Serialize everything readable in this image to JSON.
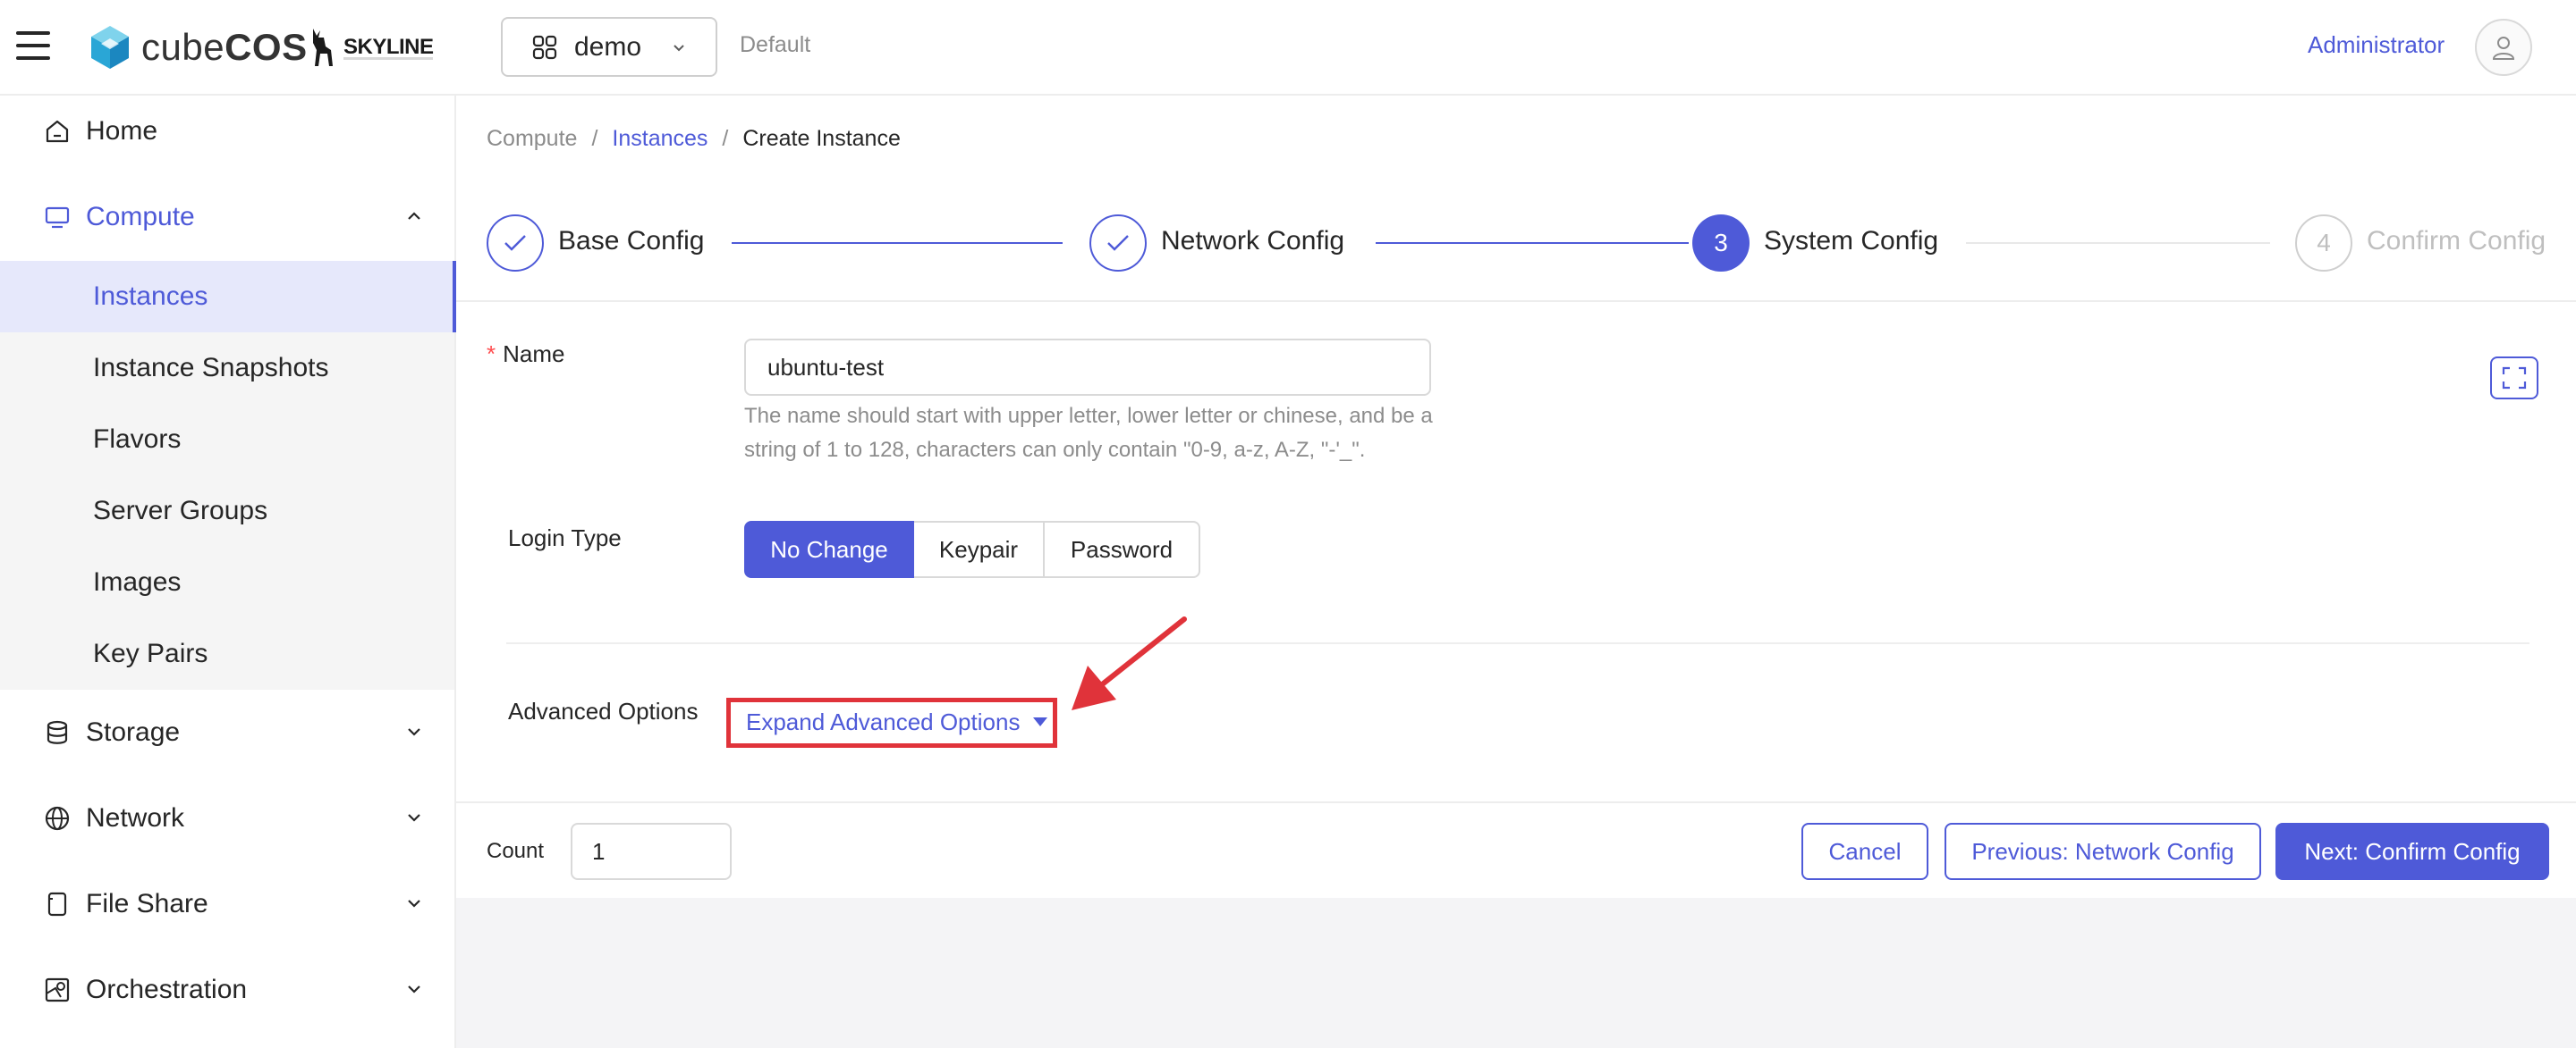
{
  "header": {
    "brand_prefix": "cube",
    "brand_suffix": "COS",
    "partner_logo_text": "SKYLINE",
    "project": "demo",
    "domain": "Default",
    "user": "Administrator"
  },
  "sidebar": {
    "items": [
      {
        "label": "Home",
        "icon": "home-icon"
      },
      {
        "label": "Compute",
        "icon": "monitor-icon",
        "expanded": true
      },
      {
        "label": "Storage",
        "icon": "database-icon"
      },
      {
        "label": "Network",
        "icon": "globe-icon"
      },
      {
        "label": "File Share",
        "icon": "file-share-icon"
      },
      {
        "label": "Orchestration",
        "icon": "orchestration-icon"
      }
    ],
    "compute_sub": [
      {
        "label": "Instances",
        "active": true
      },
      {
        "label": "Instance Snapshots"
      },
      {
        "label": "Flavors"
      },
      {
        "label": "Server Groups"
      },
      {
        "label": "Images"
      },
      {
        "label": "Key Pairs"
      }
    ]
  },
  "breadcrumb": [
    "Compute",
    "Instances",
    "Create Instance"
  ],
  "steps": [
    {
      "label": "Base Config",
      "state": "done"
    },
    {
      "label": "Network Config",
      "state": "done"
    },
    {
      "number": "3",
      "label": "System Config",
      "state": "current"
    },
    {
      "number": "4",
      "label": "Confirm Config",
      "state": "todo"
    }
  ],
  "form": {
    "name_label": "Name",
    "name_value": "ubuntu-test",
    "name_hint": "The name should start with upper letter, lower letter or chinese, and be a string of 1 to 128, characters can only contain \"0-9, a-z, A-Z, \"-'_\".",
    "login_type_label": "Login Type",
    "login_options": [
      "No Change",
      "Keypair",
      "Password"
    ],
    "login_selected": "No Change",
    "advanced_label": "Advanced Options",
    "advanced_link": "Expand Advanced Options"
  },
  "footer": {
    "count_label": "Count",
    "count_value": "1",
    "cancel": "Cancel",
    "previous": "Previous: Network Config",
    "next": "Next: Confirm Config"
  },
  "colors": {
    "accent": "#4e5ad8",
    "annotation": "#e0333a",
    "required": "#ff4d4f"
  }
}
